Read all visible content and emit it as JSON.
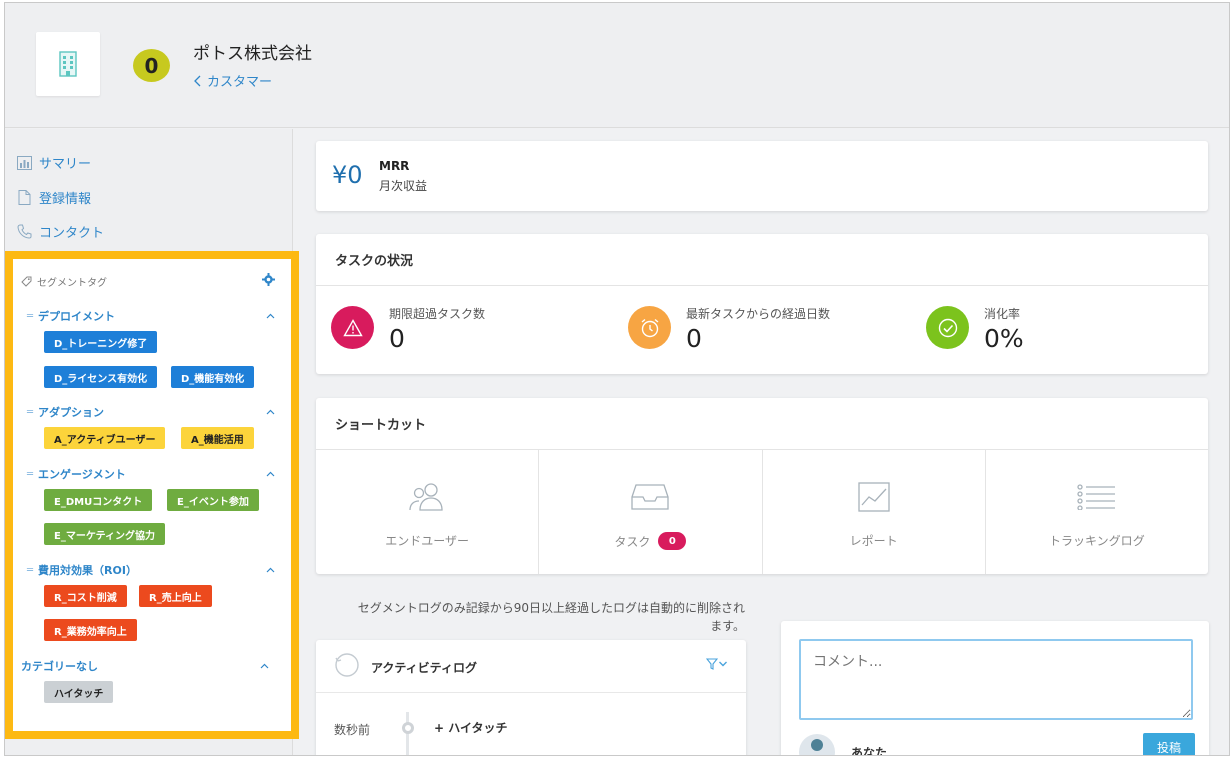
{
  "header": {
    "company_name": "ポトス株式会社",
    "score": "0",
    "breadcrumb": "カスタマー"
  },
  "sidebar": {
    "items": [
      {
        "label": "サマリー",
        "icon": "bar-chart-icon"
      },
      {
        "label": "登録情報",
        "icon": "document-icon"
      },
      {
        "label": "コンタクト",
        "icon": "phone-icon"
      }
    ],
    "segment_title": "セグメントタグ",
    "groups": [
      {
        "title": "デプロイメント",
        "color": "blue",
        "tags": [
          "D_トレーニング修了",
          "D_ライセンス有効化",
          "D_機能有効化"
        ]
      },
      {
        "title": "アダプション",
        "color": "yellow",
        "tags": [
          "A_アクティブユーザー",
          "A_機能活用"
        ]
      },
      {
        "title": "エンゲージメント",
        "color": "green",
        "tags": [
          "E_DMUコンタクト",
          "E_イベント参加",
          "E_マーケティング協力"
        ]
      },
      {
        "title": "費用対効果（ROI）",
        "color": "red",
        "tags": [
          "R_コスト削減",
          "R_売上向上",
          "R_業務効率向上"
        ]
      },
      {
        "title": "カテゴリーなし",
        "color": "gray",
        "tags": [
          "ハイタッチ"
        ]
      }
    ]
  },
  "mrr": {
    "value": "¥0",
    "title": "MRR",
    "subtitle": "月次収益"
  },
  "task_status": {
    "title": "タスクの状況",
    "stats": [
      {
        "label": "期限超過タスク数",
        "value": "0",
        "color": "#d81b5d",
        "icon": "warning-icon"
      },
      {
        "label": "最新タスクからの経過日数",
        "value": "0",
        "color": "#f7a543",
        "icon": "alarm-clock-icon"
      },
      {
        "label": "消化率",
        "value": "0%",
        "color": "#7cc31d",
        "icon": "check-icon"
      }
    ]
  },
  "shortcuts": {
    "title": "ショートカット",
    "items": [
      {
        "label": "エンドユーザー",
        "icon": "users-icon"
      },
      {
        "label": "タスク",
        "icon": "inbox-icon",
        "badge": "0"
      },
      {
        "label": "レポート",
        "icon": "line-chart-icon"
      },
      {
        "label": "トラッキングログ",
        "icon": "list-icon"
      }
    ]
  },
  "log_note": {
    "line1": "セグメントログのみ記録から90日以上経過したログは自動的に削除され",
    "line2": "ます。"
  },
  "activity": {
    "title": "アクティビティログ",
    "entries": [
      {
        "time": "数秒前",
        "event": "+ ハイタッチ"
      }
    ]
  },
  "comment": {
    "placeholder": "コメント...",
    "user": "あなた",
    "post_label": "投稿"
  },
  "colors": {
    "accent": "#2f86c9",
    "highlight_border": "#fdb913",
    "tag_blue": "#1e7fd8",
    "tag_yellow": "#fcd43b",
    "tag_green": "#6fac40",
    "tag_red": "#ec4a1e",
    "tag_gray": "#cbd0d4"
  }
}
